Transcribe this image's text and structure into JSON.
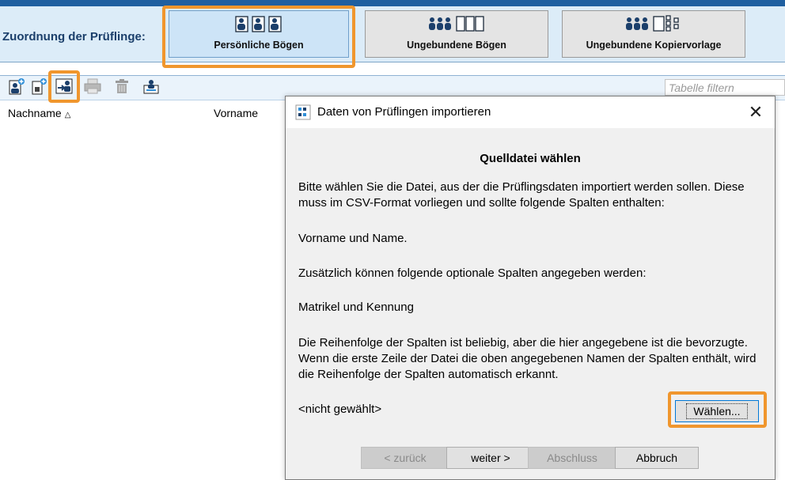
{
  "header": {
    "assign_label": "Zuordnung der Prüflinge:",
    "modes": [
      {
        "label": "Persönliche Bögen",
        "icon": "persons-sheets-icon",
        "active": true
      },
      {
        "label": "Ungebundene Bögen",
        "icon": "persons-blank-sheets-icon",
        "active": false
      },
      {
        "label": "Ungebundene Kopiervorlage",
        "icon": "persons-copy-template-icon",
        "active": false
      }
    ]
  },
  "toolbar": {
    "buttons": [
      "add-person-icon",
      "add-person-sheet-icon",
      "import-persons-icon",
      "print-icon",
      "delete-icon",
      "export-person-icon"
    ],
    "filter_placeholder": "Tabelle filtern"
  },
  "table": {
    "columns": [
      {
        "label": "Nachname",
        "sorted": "asc"
      },
      {
        "label": "Vorname"
      }
    ]
  },
  "dialog": {
    "title": "Daten von Prüflingen importieren",
    "heading": "Quelldatei wählen",
    "paragraphs": [
      "Bitte wählen Sie die Datei, aus der die Prüflingsdaten importiert werden sollen. Diese muss im CSV-Format vorliegen und sollte folgende Spalten enthalten:",
      "Vorname und Name.",
      "Zusätzlich können folgende optionale Spalten angegeben werden:",
      "Matrikel und Kennung",
      "Die Reihenfolge der Spalten ist beliebig, aber die hier angegebene ist die bevorzugte. Wenn die erste Zeile der Datei die oben angegebenen Namen der Spalten enthält, wird die Reihenfolge der Spalten automatisch erkannt."
    ],
    "selected_file": "<nicht gewählt>",
    "choose_label": "Wählen...",
    "buttons": {
      "back": "< zurück",
      "next": "weiter >",
      "finish": "Abschluss",
      "cancel": "Abbruch"
    }
  },
  "colors": {
    "highlight": "#f0962d",
    "header_bg": "#dcecf8",
    "accent": "#0078d7"
  }
}
